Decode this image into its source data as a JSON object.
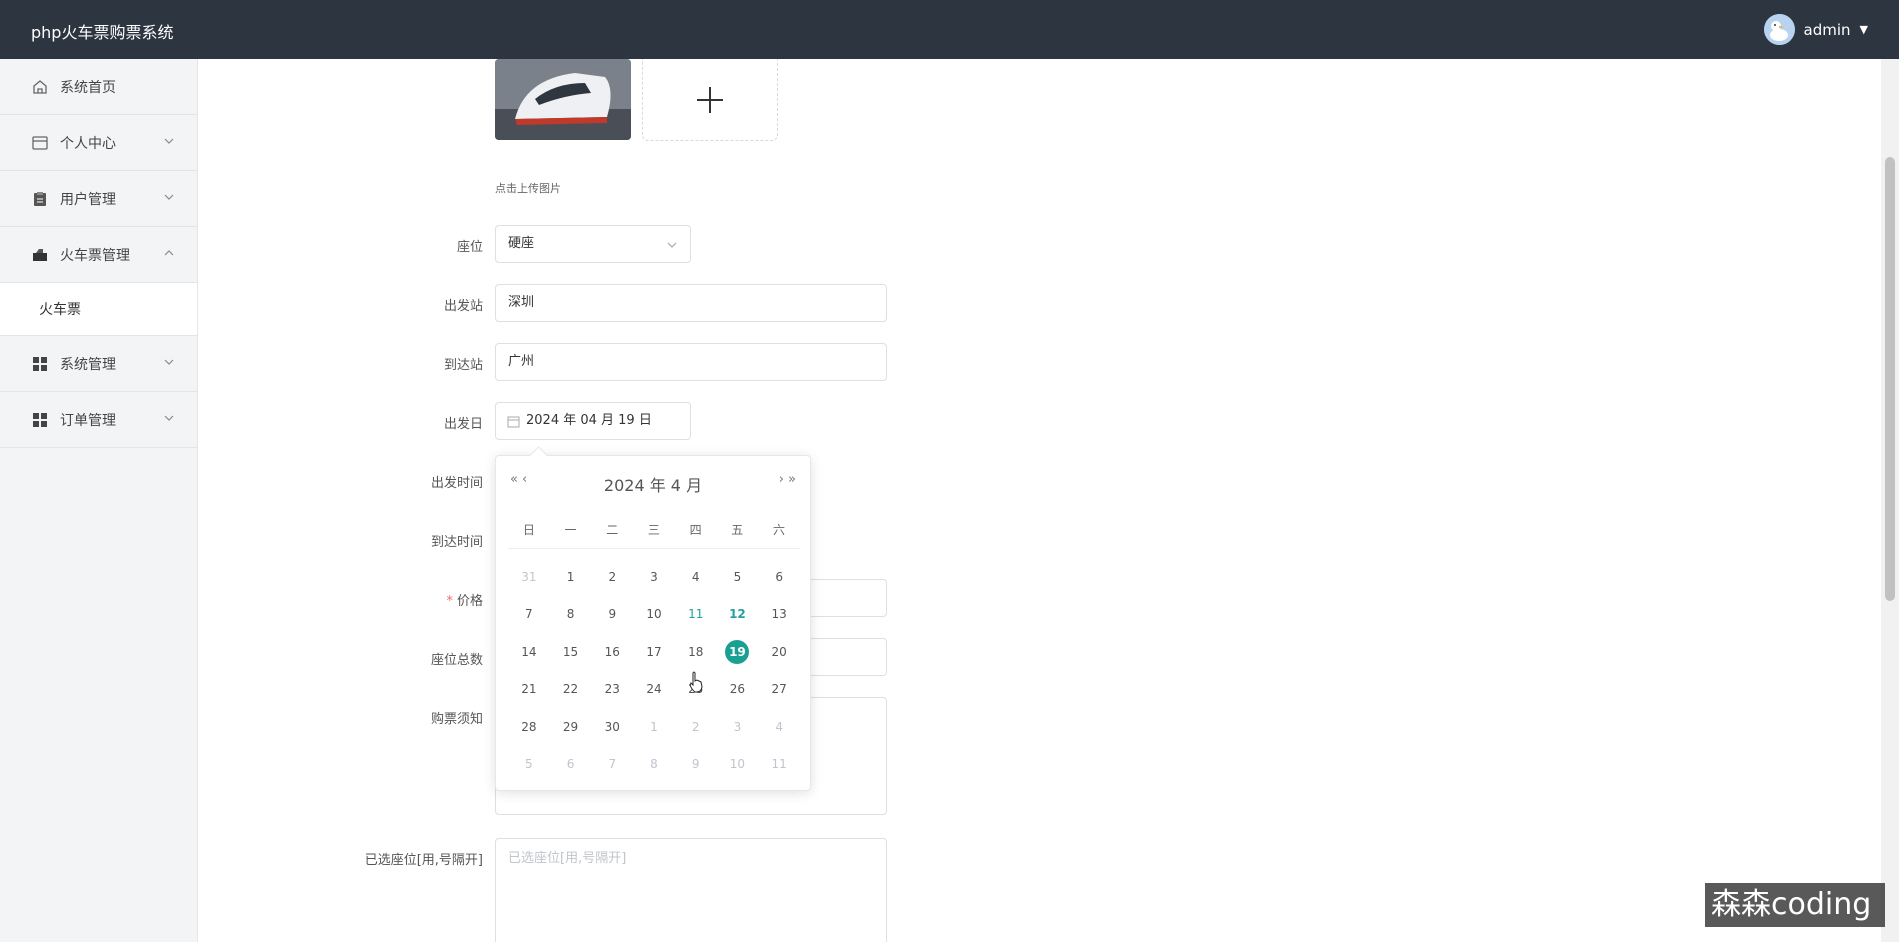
{
  "header": {
    "app_title": "php火车票购票系统",
    "user_name": "admin"
  },
  "sidebar": {
    "items": [
      {
        "label": "系统首页",
        "icon": "home-icon"
      },
      {
        "label": "个人中心",
        "icon": "card-icon"
      },
      {
        "label": "用户管理",
        "icon": "clipboard-icon"
      },
      {
        "label": "火车票管理",
        "icon": "train-ticket-icon",
        "expanded": true
      },
      {
        "label": "系统管理",
        "icon": "grid-icon"
      },
      {
        "label": "订单管理",
        "icon": "grid-icon"
      }
    ],
    "sub_item": "火车票"
  },
  "form": {
    "upload_tip": "点击上传图片",
    "seat": {
      "label": "座位",
      "value": "硬座"
    },
    "departure_station": {
      "label": "出发站",
      "value": "深圳"
    },
    "arrival_station": {
      "label": "到达站",
      "value": "广州"
    },
    "departure_date": {
      "label": "出发日",
      "value": "2024 年 04 月 19 日"
    },
    "departure_time": {
      "label": "出发时间"
    },
    "arrival_time": {
      "label": "到达时间"
    },
    "price": {
      "label": "价格",
      "required_mark": "*"
    },
    "total_seats": {
      "label": "座位总数"
    },
    "notice": {
      "label": "购票须知"
    },
    "selected_seats": {
      "label": "已选座位[用,号隔开]",
      "placeholder": "已选座位[用,号隔开]"
    }
  },
  "date_picker": {
    "title": "2024 年  4 月",
    "prev_year": "«",
    "prev_month": "‹",
    "next_month": "›",
    "next_year": "»",
    "weekdays": [
      "日",
      "一",
      "二",
      "三",
      "四",
      "五",
      "六"
    ],
    "days": [
      {
        "d": "31",
        "t": "other"
      },
      {
        "d": "1"
      },
      {
        "d": "2"
      },
      {
        "d": "3"
      },
      {
        "d": "4"
      },
      {
        "d": "5"
      },
      {
        "d": "6"
      },
      {
        "d": "7"
      },
      {
        "d": "8"
      },
      {
        "d": "9"
      },
      {
        "d": "10"
      },
      {
        "d": "11",
        "t": "hover"
      },
      {
        "d": "12",
        "t": "today"
      },
      {
        "d": "13"
      },
      {
        "d": "14"
      },
      {
        "d": "15"
      },
      {
        "d": "16"
      },
      {
        "d": "17"
      },
      {
        "d": "18"
      },
      {
        "d": "19",
        "t": "selected"
      },
      {
        "d": "20"
      },
      {
        "d": "21"
      },
      {
        "d": "22"
      },
      {
        "d": "23"
      },
      {
        "d": "24"
      },
      {
        "d": "25"
      },
      {
        "d": "26"
      },
      {
        "d": "27"
      },
      {
        "d": "28"
      },
      {
        "d": "29"
      },
      {
        "d": "30"
      },
      {
        "d": "1",
        "t": "other"
      },
      {
        "d": "2",
        "t": "other"
      },
      {
        "d": "3",
        "t": "other"
      },
      {
        "d": "4",
        "t": "other"
      },
      {
        "d": "5",
        "t": "other"
      },
      {
        "d": "6",
        "t": "other"
      },
      {
        "d": "7",
        "t": "other"
      },
      {
        "d": "8",
        "t": "other"
      },
      {
        "d": "9",
        "t": "other"
      },
      {
        "d": "10",
        "t": "other"
      },
      {
        "d": "11",
        "t": "other"
      }
    ]
  },
  "watermark": "森森coding",
  "colors": {
    "topbar": "#2c3540",
    "accent": "#1aa093",
    "required": "#f56c6c"
  }
}
